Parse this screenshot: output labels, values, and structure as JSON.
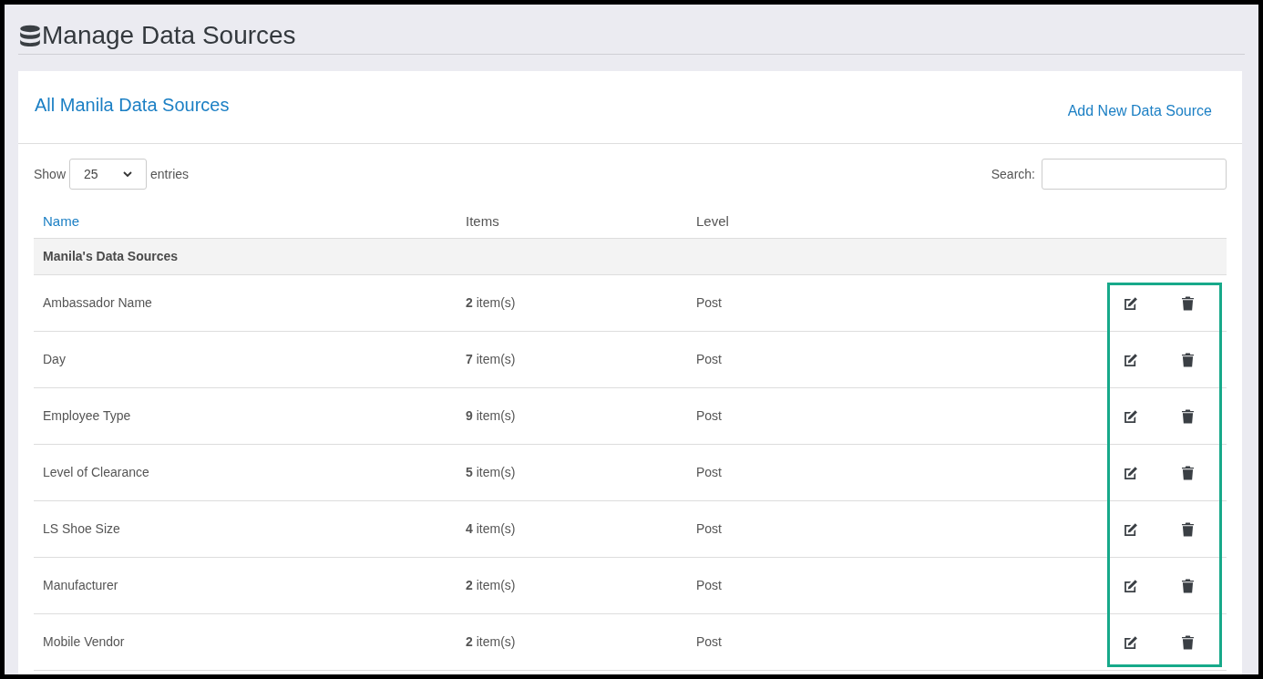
{
  "page_title": "Manage Data Sources",
  "card": {
    "title": "All Manila Data Sources",
    "add_link": "Add New Data Source"
  },
  "length_control": {
    "before": "Show",
    "value": "25",
    "after": "entries"
  },
  "search": {
    "label": "Search:"
  },
  "table": {
    "columns": [
      "Name",
      "Items",
      "Level"
    ],
    "group": "Manila's Data Sources",
    "rows": [
      {
        "name": "Ambassador Name",
        "items": "**2** item(s)",
        "level": "Post"
      },
      {
        "name": "Day",
        "items": "**7** item(s)",
        "level": "Post"
      },
      {
        "name": "Employee Type",
        "items": "**9** item(s)",
        "level": "Post"
      },
      {
        "name": "Level of Clearance",
        "items": "**5** item(s)",
        "level": "Post"
      },
      {
        "name": "LS Shoe Size",
        "items": "**4** item(s)",
        "level": "Post"
      },
      {
        "name": "Manufacturer",
        "items": "**2** item(s)",
        "level": "Post"
      },
      {
        "name": "Mobile Vendor",
        "items": "**2** item(s)",
        "level": "Post"
      }
    ]
  },
  "actions_highlighted": true
}
